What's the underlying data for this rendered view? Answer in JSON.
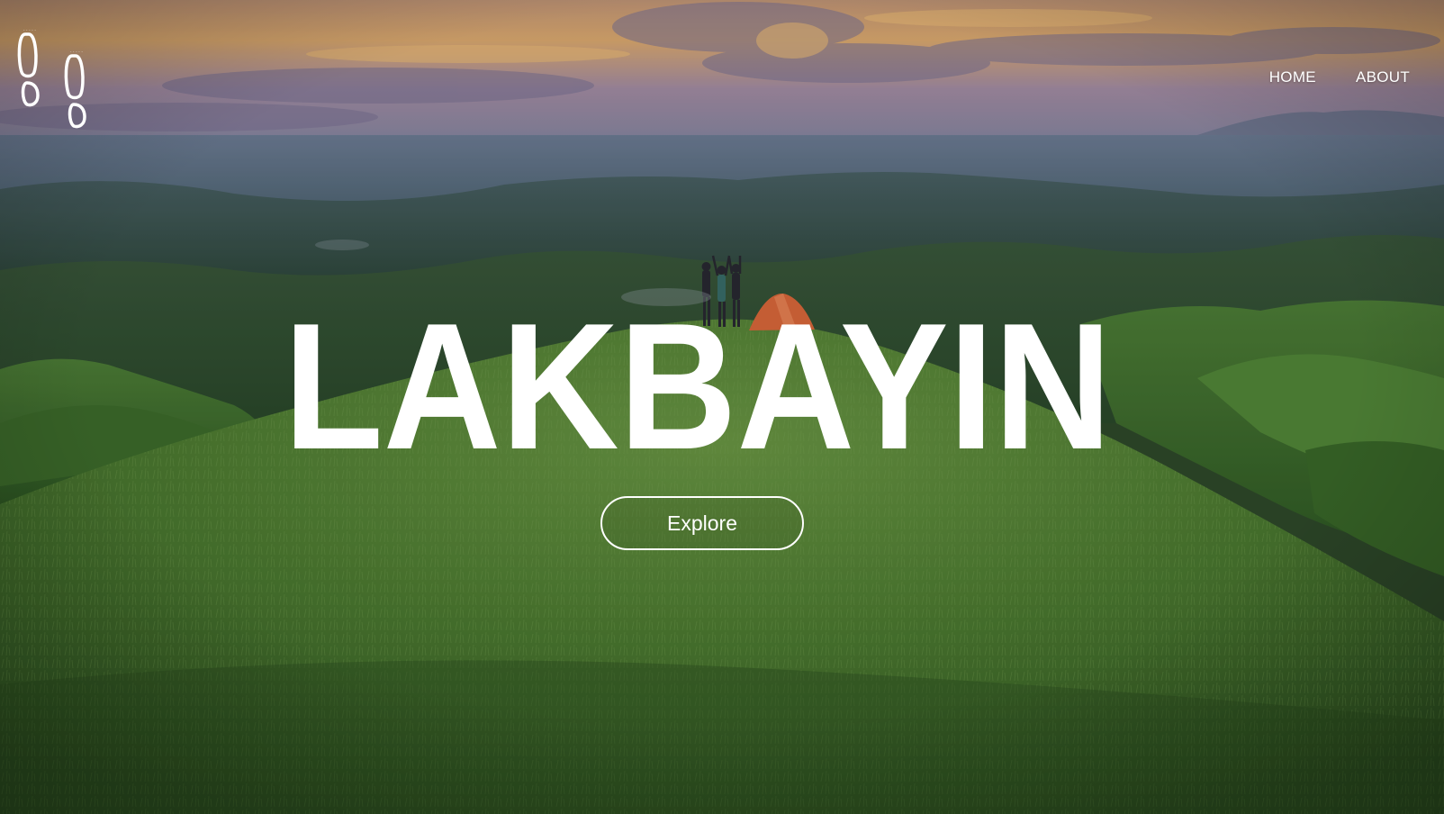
{
  "nav": {
    "logo_icon": "footprints-icon",
    "links": [
      {
        "label": "HOME"
      },
      {
        "label": "ABOUT"
      }
    ]
  },
  "hero": {
    "title": "LAKBAYIN",
    "cta_label": "Explore",
    "background_image": "aerial-grassy-hills-sunset-hikers-tent"
  },
  "colors": {
    "text": "#ffffff",
    "grass": "#4a7a30",
    "sky_warm": "#e9b06a",
    "sky_cool": "#8a8fb5"
  }
}
